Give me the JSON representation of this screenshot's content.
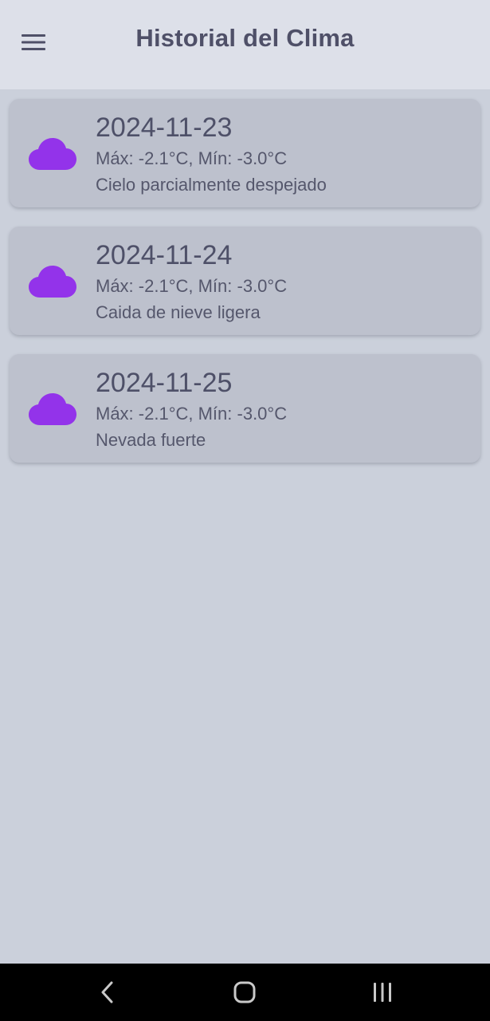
{
  "app_bar": {
    "title": "Historial del Clima",
    "menu_icon": "hamburger-menu-icon"
  },
  "records": [
    {
      "date": "2024-11-23",
      "temps": "Máx: -2.1°C, Mín: -3.0°C",
      "description": "Cielo parcialmente despejado",
      "icon": "cloud-icon"
    },
    {
      "date": "2024-11-24",
      "temps": "Máx: -2.1°C, Mín: -3.0°C",
      "description": "Caida de nieve ligera",
      "icon": "cloud-icon"
    },
    {
      "date": "2024-11-25",
      "temps": "Máx: -2.1°C, Mín: -3.0°C",
      "description": "Nevada fuerte",
      "icon": "cloud-icon"
    }
  ],
  "nav": {
    "back_icon": "back-chevron-icon",
    "home_icon": "home-icon",
    "recents_icon": "recents-icon"
  },
  "colors": {
    "accent_icon": "#9333ea",
    "background": "#cbd0db",
    "app_bar": "#dde0e9",
    "card": "#bdc1cd",
    "text": "#4e5068"
  }
}
